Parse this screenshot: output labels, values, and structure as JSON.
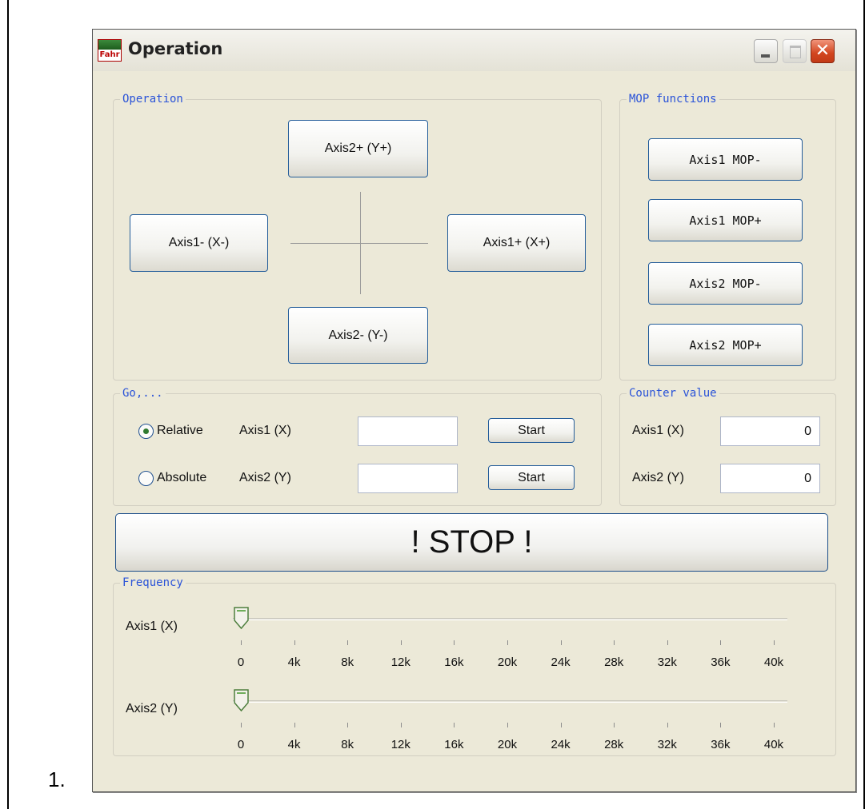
{
  "list_marker": "1.",
  "window": {
    "title": "Operation",
    "app_icon_text": "Fahr",
    "controls": [
      "minimize-icon",
      "maximize-icon",
      "close-icon"
    ]
  },
  "operation": {
    "label": "Operation",
    "axis2_plus": "Axis2+ (Y+)",
    "axis1_minus": "Axis1- (X-)",
    "axis1_plus": "Axis1+ (X+)",
    "axis2_minus": "Axis2- (Y-)"
  },
  "mop": {
    "label": "MOP functions",
    "buttons": [
      "Axis1 MOP-",
      "Axis1 MOP+",
      "Axis2 MOP-",
      "Axis2 MOP+"
    ]
  },
  "go": {
    "label": "Go,...",
    "relative_label": "Relative",
    "absolute_label": "Absolute",
    "relative_selected": true,
    "axis1_label": "Axis1 (X)",
    "axis2_label": "Axis2 (Y)",
    "axis1_value": "",
    "axis2_value": "",
    "start_label": "Start"
  },
  "counter": {
    "label": "Counter value",
    "axis1_label": "Axis1 (X)",
    "axis2_label": "Axis2 (Y)",
    "axis1_value": "0",
    "axis2_value": "0"
  },
  "stop_label": "! STOP !",
  "frequency": {
    "label": "Frequency",
    "axis1_label": "Axis1 (X)",
    "axis2_label": "Axis2 (Y)",
    "tick_labels": [
      "0",
      "4k",
      "8k",
      "12k",
      "16k",
      "20k",
      "24k",
      "28k",
      "32k",
      "36k",
      "40k"
    ],
    "axis1_value": 0,
    "axis2_value": 0,
    "max": 40000
  },
  "colors": {
    "group_label": "#2a53d8",
    "window_bg": "#ece9d8",
    "button_border": "#245d9a",
    "close_button": "#d2461f"
  }
}
